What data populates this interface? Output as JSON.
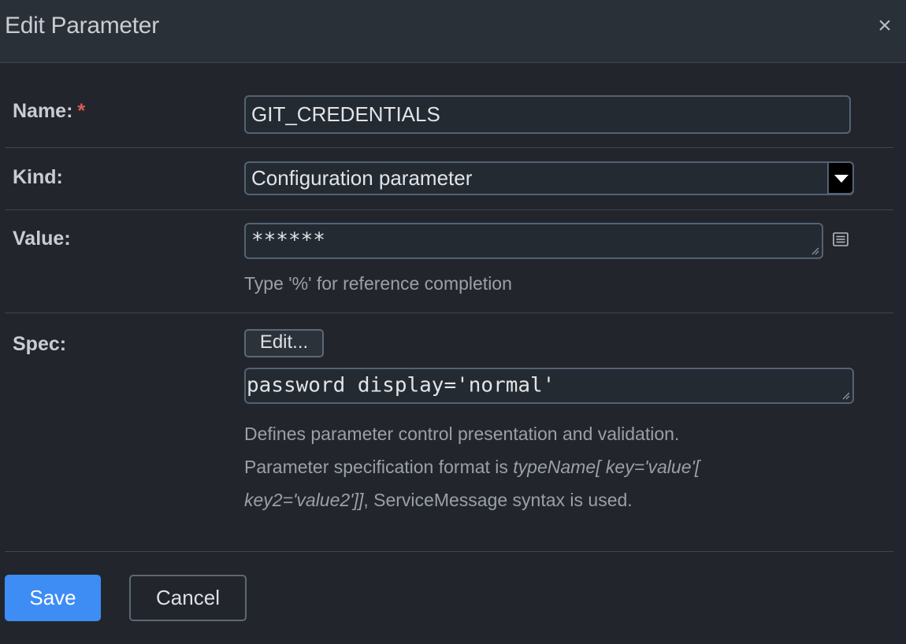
{
  "dialog": {
    "title": "Edit Parameter",
    "close_glyph": "×",
    "close_icon": "close-icon"
  },
  "form": {
    "name": {
      "label": "Name:",
      "required_mark": "*",
      "value": "GIT_CREDENTIALS"
    },
    "kind": {
      "label": "Kind:",
      "selected": "Configuration parameter"
    },
    "value": {
      "label": "Value:",
      "masked_value": "******",
      "hint": "Type '%' for reference completion",
      "side_icon": "list-icon"
    },
    "spec": {
      "label": "Spec:",
      "edit_button": "Edit...",
      "value": "password display='normal'",
      "hint_line1": "Defines parameter control presentation and validation.",
      "hint_line2_prefix": "Parameter specification format is ",
      "hint_format_a": "typeName[ key='value'[",
      "hint_format_b": "key2='value2']]",
      "hint_line3_suffix": ", ServiceMessage syntax is used."
    }
  },
  "footer": {
    "save_label": "Save",
    "cancel_label": "Cancel"
  },
  "colors": {
    "accent": "#3d8df5",
    "required": "#e05a5a",
    "background": "#22262c",
    "field_border": "#536274"
  }
}
